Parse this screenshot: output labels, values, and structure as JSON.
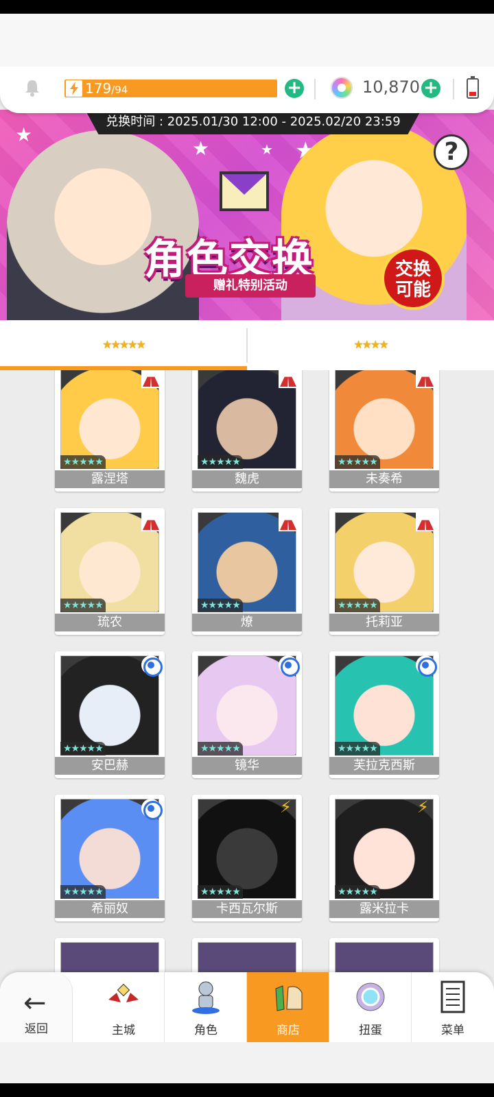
{
  "resources": {
    "energy_current": "179",
    "energy_max": "/94",
    "gems": "10,870"
  },
  "banner": {
    "exchange_time": "兑换时间 : 2025.01/30 12:00 - 2025.02/20 23:59",
    "title": "角色交换",
    "subtitle": "赠礼特别活动",
    "seal_line1": "交换",
    "seal_line2": "可能",
    "help": "?"
  },
  "tabs": [
    {
      "label": "★★★★★",
      "active": true
    },
    {
      "label": "★★★★",
      "active": false
    }
  ],
  "characters": [
    {
      "name": "露涅塔",
      "rarity": "★★★★★",
      "element": "red"
    },
    {
      "name": "魏虎",
      "rarity": "★★★★★",
      "element": "red"
    },
    {
      "name": "未奏希",
      "rarity": "★★★★★",
      "element": "red"
    },
    {
      "name": "琉农",
      "rarity": "★★★★★",
      "element": "red"
    },
    {
      "name": "燎",
      "rarity": "★★★★★",
      "element": "red"
    },
    {
      "name": "托莉亚",
      "rarity": "★★★★★",
      "element": "red"
    },
    {
      "name": "安巴赫",
      "rarity": "★★★★★",
      "element": "blue"
    },
    {
      "name": "镜华",
      "rarity": "★★★★★",
      "element": "blue"
    },
    {
      "name": "芙拉克西斯",
      "rarity": "★★★★★",
      "element": "blue"
    },
    {
      "name": "希丽奴",
      "rarity": "★★★★★",
      "element": "blue"
    },
    {
      "name": "卡西瓦尔斯",
      "rarity": "★★★★★",
      "element": "yellow"
    },
    {
      "name": "露米拉卡",
      "rarity": "★★★★★",
      "element": "yellow"
    }
  ],
  "nav": {
    "back": "返回",
    "items": [
      {
        "label": "主城",
        "icon": "castle-icon"
      },
      {
        "label": "角色",
        "icon": "character-icon"
      },
      {
        "label": "商店",
        "icon": "shop-icon",
        "active": true
      },
      {
        "label": "扭蛋",
        "icon": "gacha-icon"
      },
      {
        "label": "菜单",
        "icon": "menu-icon"
      }
    ]
  },
  "colors": {
    "accent": "#f89a21",
    "plus": "#24b883",
    "card_label": "#9c9c9c"
  }
}
